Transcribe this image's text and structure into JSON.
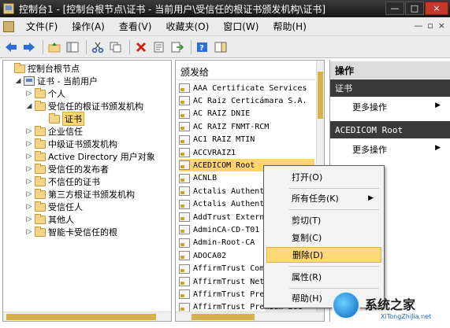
{
  "window": {
    "title": "控制台1 - [控制台根节点\\证书 - 当前用户\\受信任的根证书颁发机构\\证书]",
    "buttons": [
      "—",
      "□",
      "×"
    ]
  },
  "menu": {
    "items": [
      "文件(F)",
      "操作(A)",
      "查看(V)",
      "收藏夹(O)",
      "窗口(W)",
      "帮助(H)"
    ],
    "right": [
      "—",
      "▫",
      "×"
    ]
  },
  "toolbar": {
    "icons": [
      "back-icon",
      "forward-icon",
      "up-folder-icon",
      "show-tree-icon",
      "cut-icon",
      "copy-icon",
      "delete-icon",
      "properties-icon",
      "export-icon",
      "help-icon",
      "action-pane-icon"
    ]
  },
  "tree": {
    "items": [
      {
        "label": "控制台根节点",
        "level": 0,
        "expander": ""
      },
      {
        "label": "证书 - 当前用户",
        "level": 1,
        "expander": "◢"
      },
      {
        "label": "个人",
        "level": 2,
        "expander": "▷"
      },
      {
        "label": "受信任的根证书颁发机构",
        "level": 2,
        "expander": "◢"
      },
      {
        "label": "证书",
        "level": 3,
        "expander": ""
      },
      {
        "label": "企业信任",
        "level": 2,
        "expander": "▷"
      },
      {
        "label": "中级证书颁发机构",
        "level": 2,
        "expander": "▷"
      },
      {
        "label": "Active Directory 用户对象",
        "level": 2,
        "expander": "▷"
      },
      {
        "label": "受信任的发布者",
        "level": 2,
        "expander": "▷"
      },
      {
        "label": "不信任的证书",
        "level": 2,
        "expander": "▷"
      },
      {
        "label": "第三方根证书颁发机构",
        "level": 2,
        "expander": "▷"
      },
      {
        "label": "受信任人",
        "level": 2,
        "expander": "▷"
      },
      {
        "label": "其他人",
        "level": 2,
        "expander": "▷"
      },
      {
        "label": "智能卡受信任的根",
        "level": 2,
        "expander": "▷"
      }
    ]
  },
  "list": {
    "header": "颁发给",
    "rows": [
      "AAA Certificate Services",
      "AC Raíz Certicámara S.A.",
      "AC RAIZ DNIE",
      "AC RAIZ FNMT-RCM",
      "AC1 RAIZ MTIN",
      "ACCVRAIZ1",
      "ACEDICOM Root",
      "ACNLB",
      "Actalis Authentication",
      "Actalis Authentication",
      "AddTrust External",
      "AdminCA-CD-T01",
      "Admin-Root-CA",
      "ADOCA02",
      "AffirmTrust Commercial",
      "AffirmTrust Networking",
      "AffirmTrust Premium",
      "AffirmTrust Premium ECC"
    ],
    "selected": "ACEDICOM Root"
  },
  "actions": {
    "header": "操作",
    "sections": [
      {
        "title": "证书",
        "item": "更多操作"
      },
      {
        "title": "ACEDICOM Root",
        "item": "更多操作"
      }
    ]
  },
  "context_menu": {
    "items": [
      "打开(O)",
      "所有任务(K)",
      "剪切(T)",
      "复制(C)",
      "删除(D)",
      "属性(R)",
      "帮助(H)"
    ],
    "highlighted": "删除(D)"
  },
  "watermark": {
    "text": "系统之家",
    "url": "XiTongZhiJia.net"
  }
}
